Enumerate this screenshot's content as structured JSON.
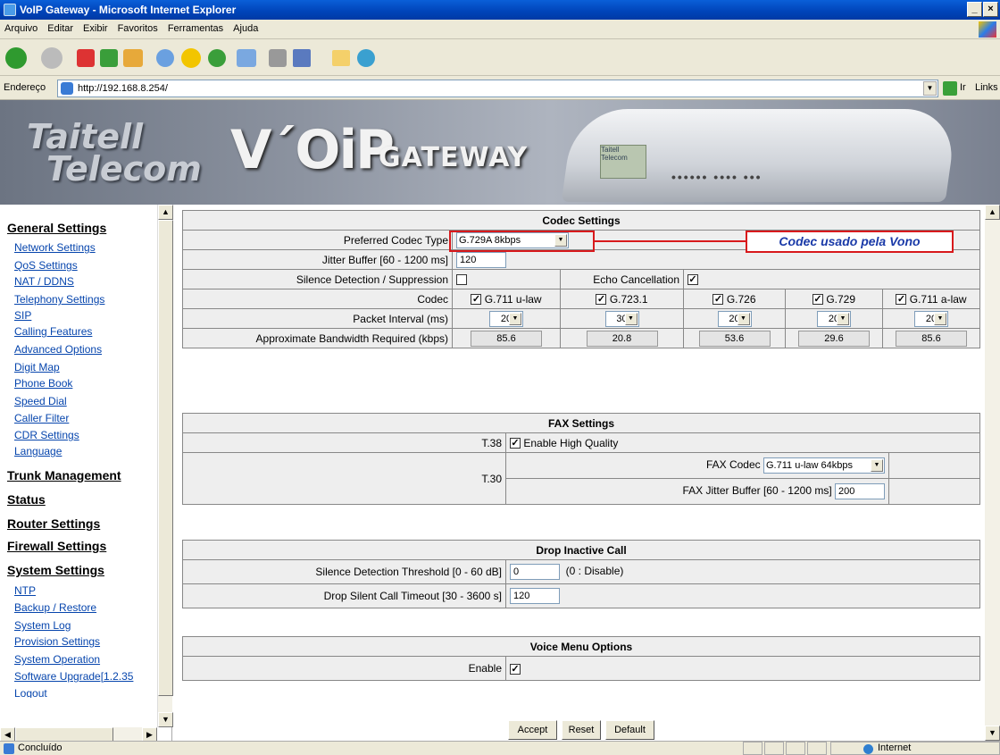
{
  "window": {
    "title": "VoIP Gateway - Microsoft Internet Explorer",
    "min": "_",
    "max": "×"
  },
  "menu": [
    "Arquivo",
    "Editar",
    "Exibir",
    "Favoritos",
    "Ferramentas",
    "Ajuda"
  ],
  "address": {
    "label": "Endereço",
    "url": "http://192.168.8.254/",
    "go": "Ir",
    "links": "Links"
  },
  "banner": {
    "company_line1": "Taitell",
    "company_line2": "Telecom",
    "product": "V´OiP",
    "product_suffix": "GATEWAY",
    "device_label": "Taitell Telecom"
  },
  "sidebar": {
    "general": "General Settings",
    "general_items": [
      "Network Settings",
      "QoS Settings",
      "NAT / DDNS",
      "Telephony Settings",
      "SIP",
      "Calling Features",
      "Advanced Options",
      "Digit Map",
      "Phone Book",
      "Speed Dial",
      "Caller Filter",
      "CDR Settings",
      "Language"
    ],
    "trunk": "Trunk Management",
    "status": "Status",
    "router": "Router Settings",
    "firewall": "Firewall Settings",
    "system": "System Settings",
    "system_items": [
      "NTP",
      "Backup / Restore",
      "System Log",
      "Provision Settings",
      "System Operation",
      "Software Upgrade[1.2.35",
      "Logout"
    ]
  },
  "codec": {
    "title": "Codec Settings",
    "pref_label": "Preferred Codec Type",
    "pref_value": "G.729A 8kbps",
    "annotation": "Codec usado pela Vono",
    "jitter_label": "Jitter Buffer [60 - 1200 ms]",
    "jitter_value": "120",
    "silence_label": "Silence Detection / Suppression",
    "echo_label": "Echo Cancellation",
    "codec_label": "Codec",
    "codecs": [
      "G.711 u-law",
      "G.723.1",
      "G.726",
      "G.729",
      "G.711 a-law"
    ],
    "packet_label": "Packet Interval (ms)",
    "packets": [
      "20",
      "30",
      "20",
      "20",
      "20"
    ],
    "bw_label": "Approximate Bandwidth Required (kbps)",
    "bandwidth": [
      "85.6",
      "20.8",
      "53.6",
      "29.6",
      "85.6"
    ]
  },
  "fax": {
    "title": "FAX Settings",
    "t38": "T.38",
    "t38_opt": "Enable High Quality",
    "t30": "T.30",
    "codec_label": "FAX Codec",
    "codec_value": "G.711 u-law 64kbps",
    "jitter_label": "FAX Jitter Buffer [60 - 1200 ms]",
    "jitter_value": "200"
  },
  "drop": {
    "title": "Drop Inactive Call",
    "thr_label": "Silence Detection Threshold [0 - 60 dB]",
    "thr_value": "0",
    "thr_note": "(0 : Disable)",
    "timeout_label": "Drop Silent Call Timeout [30 - 3600 s]",
    "timeout_value": "120"
  },
  "voice": {
    "title": "Voice Menu Options",
    "enable_label": "Enable"
  },
  "buttons": {
    "accept": "Accept",
    "reset": "Reset",
    "default": "Default"
  },
  "status": {
    "left": "Concluído",
    "zone": "Internet"
  },
  "accent": {
    "annotation_red": "#d8191c",
    "annotation_blue": "#1a3aa8",
    "link": "#0645ad"
  }
}
